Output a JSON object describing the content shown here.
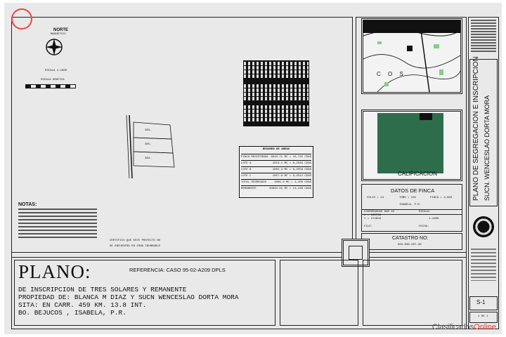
{
  "north_label": "NORTE",
  "north_sub": "MAGNETICO",
  "scale_label": "ESCALA 1:1000",
  "scale_sub": "ESCALA GRAFICA",
  "lot_labels": [
    "383-",
    "385-",
    "384-"
  ],
  "areas_table": {
    "title": "RESUMEN DE AREAS",
    "rows": [
      [
        "FINCA REGISTRADA",
        "6843.71 MC = 15,745 CDAS"
      ],
      [
        "LOTE A",
        "1013.1 MC = 0,2583 CDAS"
      ],
      [
        "LOTE B",
        "1002.3 MC = 0,2556 CDAS"
      ],
      [
        "LOTE C",
        "1057.8 MC = 0,2512 CDAS"
      ],
      [
        "TOTAL SEGREGADO",
        "4006.0 MC = 1,100 CDAS"
      ],
      [
        "REMANENTE",
        "43834.91 MC = 11,138 CDAS"
      ]
    ]
  },
  "notes": {
    "title": "NOTAS:",
    "certify": "CERTIFICO QUE ESTE PROYECTO NO",
    "certify2": "SE ENCUENTRA EN ZONA INUNDABLE"
  },
  "map_top_letters": "C O S",
  "zoning_label": "CALIFICACION",
  "finca": {
    "title": "DATOS DE FINCA",
    "folio": "FOLIO = 13",
    "tomo": "TOMO = 101",
    "finca": "FINCA = 2,983",
    "place": "ISABELA, P.R.",
    "coords_label": "COORDENADAS NAD 83",
    "x": "X = 135736",
    "y": "Y = 274659",
    "escala_label": "ESCALA:",
    "escala": "1:1000",
    "file": "FILE:",
    "fecha": "FECHA:"
  },
  "catastro": {
    "label": "CATASTRO NO:",
    "value": "003-000-007-36"
  },
  "title_block": {
    "heading": "PLANO:",
    "referencia": "REFERENCIA: CASO 95-02-A209 DPLS",
    "line1": "DE INSCRIPCION DE TRES SOLARES Y REMANENTE",
    "line2": "PROPIEDAD DE: BLANCA M DIAZ Y SUCN WENCESLAO DORTA MORA",
    "line3": "SITA: EN CARR. 459 KM. 13.8 INT.",
    "line4": "BO. BEJUCOS , ISABELA, P.R."
  },
  "side_title": {
    "line1": "PLANO DE SEGREGACION E INSCRIPCION",
    "line2": "SUCN. WENCESLAO DORTA MORA"
  },
  "sheet_no": "S-1",
  "sheet_of": "1 DE 1",
  "watermark": {
    "part1": "Clasificados",
    "part2": "Online",
    "accent": "#e8352f"
  }
}
